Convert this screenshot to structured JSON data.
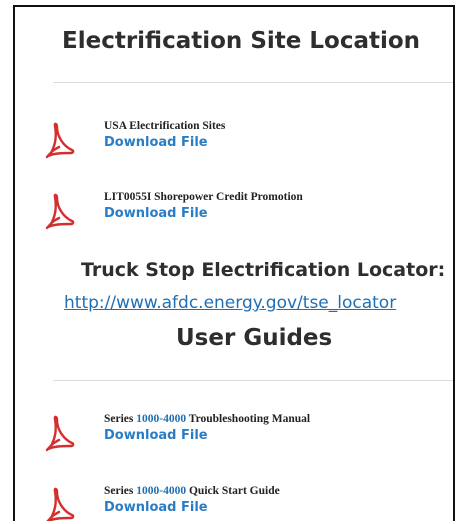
{
  "site_section": {
    "title": "Electrification Site Location",
    "files": [
      {
        "name": "USA Electrification Sites",
        "action": "Download File",
        "icon": "pdf-icon"
      },
      {
        "name": "LIT0055I Shorepower Credit Promotion",
        "action": "Download File",
        "icon": "pdf-icon"
      }
    ]
  },
  "locator": {
    "heading": "Truck Stop Electrification Locator:",
    "url": "http://www.afdc.energy.gov/tse_locator"
  },
  "guides_section": {
    "title": "User Guides",
    "files": [
      {
        "prefix": "Series ",
        "highlight": "1000-4000",
        "suffix": " Troubleshooting Manual",
        "action": "Download File",
        "icon": "pdf-icon"
      },
      {
        "prefix": "Series ",
        "highlight": "1000-4000",
        "suffix": " Quick Start Guide",
        "action": "Download File",
        "icon": "pdf-icon"
      }
    ]
  },
  "colors": {
    "link": "#1e6fb5",
    "download": "#2a7dc4",
    "pdf_red": "#d32f2f",
    "heading": "#2e2e2e"
  }
}
